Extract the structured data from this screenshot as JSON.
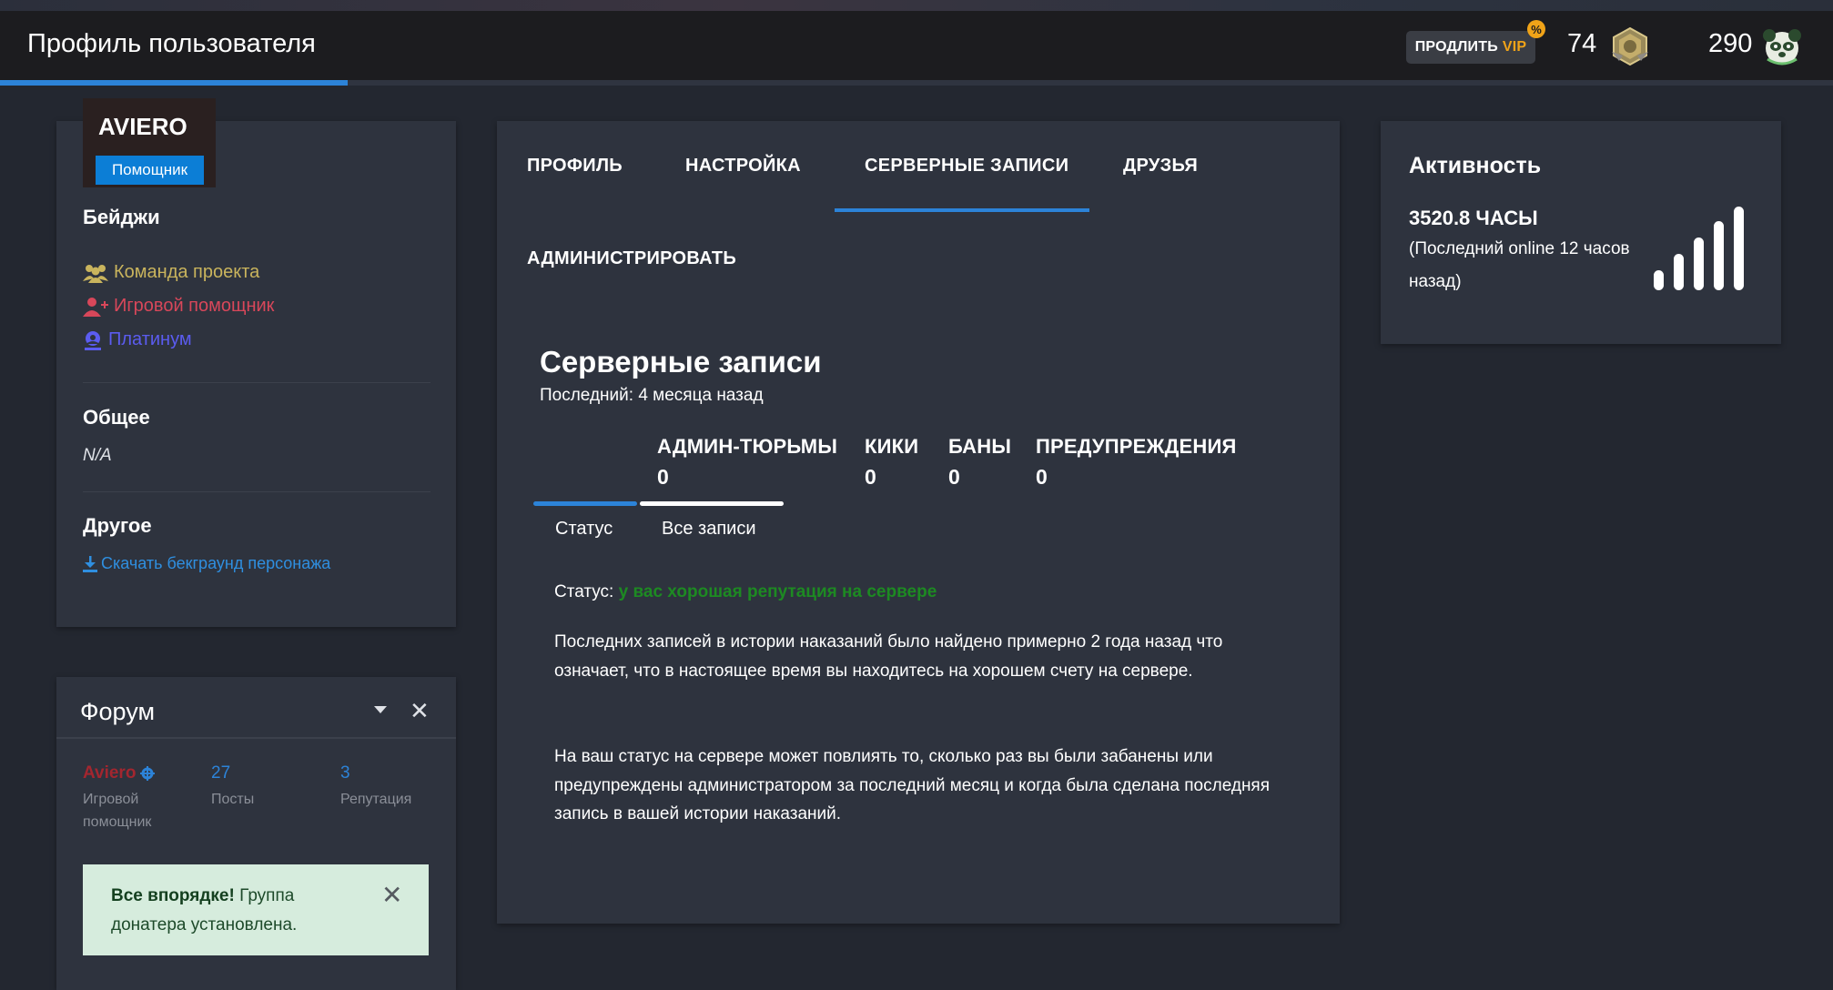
{
  "header": {
    "title": "Профиль пользователя",
    "vip_prefix": "ПРОДЛИТЬ",
    "vip_word": "VIP",
    "vip_badge": "%",
    "stat_a": "74",
    "stat_b": "290"
  },
  "profile": {
    "name": "AVIERO",
    "role": "Помощник",
    "badges_title": "Бейджи",
    "badges": [
      {
        "label": "Команда проекта",
        "color": "#c9b45d"
      },
      {
        "label": "Игровой помощник",
        "color": "#d8475a"
      },
      {
        "label": "Платинум",
        "color": "#5b5cf0"
      }
    ],
    "general_title": "Общее",
    "general_value": "N/A",
    "other_title": "Другое",
    "download_label": "Скачать бекграунд персонажа"
  },
  "forum": {
    "title": "Форум",
    "username": "Aviero",
    "user_role": "Игровой помощник",
    "posts_value": "27",
    "posts_label": "Посты",
    "rep_value": "3",
    "rep_label": "Репутация",
    "alert_bold": "Все впорядке!",
    "alert_text": " Группа донатера установлена."
  },
  "tabs": [
    "ПРОФИЛЬ",
    "НАСТРОЙКА",
    "СЕРВЕРНЫЕ ЗАПИСИ",
    "ДРУЗЬЯ",
    "АДМИНИСТРИРОВАТЬ"
  ],
  "records": {
    "title": "Серверные записи",
    "last": "Последний: 4 месяца назад",
    "counters": [
      {
        "label": "АДМИН-ТЮРЬМЫ",
        "value": "0"
      },
      {
        "label": "КИКИ",
        "value": "0"
      },
      {
        "label": "БАНЫ",
        "value": "0"
      },
      {
        "label": "ПРЕДУПРЕЖДЕНИЯ",
        "value": "0"
      }
    ],
    "subtabs": [
      "Статус",
      "Все записи"
    ],
    "status_label": "Статус:",
    "status_value": " у вас хорошая репутация на сервере",
    "paragraph_1": "Последних записей в истории наказаний было найдено примерно 2 года назад что означает, что в настоящее время вы находитесь на хорошем счету на сервере.",
    "paragraph_2": "На ваш статус на сервере может повлиять то, сколько раз вы были забанены или предупреждены администратором за последний месяц и когда была сделана последняя запись в вашей истории наказаний."
  },
  "activity": {
    "title": "Активность",
    "hours": "3520.8 ЧАСЫ",
    "last_online": "(Последний online 12 часов назад)"
  },
  "colors": {
    "accent": "#2c83d8",
    "card": "#2e333e",
    "page": "#232730",
    "good": "#1d8a22"
  }
}
